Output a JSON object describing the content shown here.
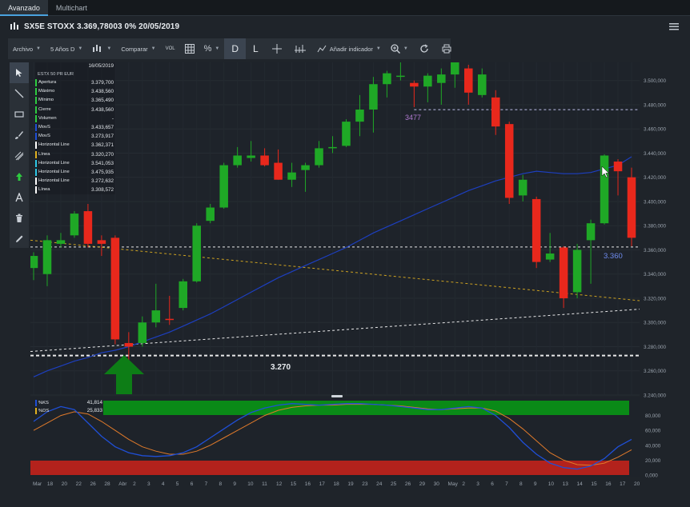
{
  "tabs": [
    {
      "label": "Avanzado",
      "active": true
    },
    {
      "label": "Multichart",
      "active": false
    }
  ],
  "header": {
    "title": "SX5E STOXX 3.369,78003 0% 20/05/2019",
    "icon": "candlestick-icon"
  },
  "toolbar": {
    "archivo": "Archivo",
    "period": "5 Años D",
    "comparar": "Comparar",
    "vol": "VOL",
    "percent": "%",
    "d": "D",
    "l": "L",
    "indicator": "Añadir indicador"
  },
  "data_panel": {
    "date": "16/05/2019",
    "instrument": "ESTX 50 PR EUR",
    "rows": [
      {
        "label": "Apertura",
        "value": "3.379,700",
        "color": "#2ecc40"
      },
      {
        "label": "Máximo",
        "value": "3.438,560",
        "color": "#2ecc40"
      },
      {
        "label": "Mínimo",
        "value": "3.365,490",
        "color": "#2ecc40"
      },
      {
        "label": "Cierre",
        "value": "3.438,560",
        "color": "#2ecc40"
      },
      {
        "label": "Volumen",
        "value": "-",
        "color": "#2ecc40"
      },
      {
        "label": "MovS",
        "value": "3.433,657",
        "color": "#1f4fd6"
      },
      {
        "label": "MovS",
        "value": "3.273,917",
        "color": "#1f4fd6"
      },
      {
        "label": "Horizontal Line",
        "value": "3.362,371",
        "color": "#ffffff"
      },
      {
        "label": "Línea",
        "value": "3.320,270",
        "color": "#e0b020"
      },
      {
        "label": "Horizontal Line",
        "value": "3.541,053",
        "color": "#2ec7e6"
      },
      {
        "label": "Horizontal Line",
        "value": "3.475,935",
        "color": "#2ec7e6"
      },
      {
        "label": "Horizontal Line",
        "value": "3.272,632",
        "color": "#ffffff"
      },
      {
        "label": "Línea",
        "value": "3.308,572",
        "color": "#ffffff"
      }
    ]
  },
  "annotations": {
    "level_3477": "3477",
    "level_3360": "3.360",
    "level_3270": "3.270"
  },
  "oscillator": {
    "rows": [
      {
        "label": "%KS",
        "value": "41,814",
        "color": "#1f4fd6"
      },
      {
        "label": "%DS",
        "value": "25,833",
        "color": "#e0b020"
      }
    ],
    "y_ticks": [
      "80,000",
      "60,000",
      "40,000",
      "20,000",
      "0,000"
    ]
  },
  "chart_data": {
    "type": "candlestick",
    "ylim": [
      3240,
      3515
    ],
    "y_ticks": [
      3240,
      3260,
      3280,
      3300,
      3320,
      3340,
      3360,
      3380,
      3400,
      3420,
      3440,
      3460,
      3480,
      3500
    ],
    "y_tick_labels": [
      "3.240,000",
      "3.260,000",
      "3.280,000",
      "3.300,000",
      "3.320,000",
      "3.340,000",
      "3.360,000",
      "3.380,000",
      "3.400,000",
      "3.420,000",
      "3.440,000",
      "3.460,000",
      "3.480,000",
      "3.500,000"
    ],
    "x_labels": [
      "Mar",
      "18",
      "20",
      "22",
      "26",
      "28",
      "Abr",
      "2",
      "3",
      "4",
      "5",
      "6",
      "7",
      "8",
      "9",
      "10",
      "11",
      "12",
      "15",
      "16",
      "17",
      "18",
      "19",
      "23",
      "24",
      "25",
      "26",
      "29",
      "30",
      "May",
      "2",
      "3",
      "6",
      "7",
      "8",
      "9",
      "10",
      "13",
      "14",
      "15",
      "16",
      "17",
      "20"
    ],
    "candles": [
      {
        "o": 3345,
        "h": 3358,
        "l": 3335,
        "c": 3355
      },
      {
        "o": 3340,
        "h": 3372,
        "l": 3330,
        "c": 3368
      },
      {
        "o": 3365,
        "h": 3374,
        "l": 3362,
        "c": 3368
      },
      {
        "o": 3372,
        "h": 3392,
        "l": 3370,
        "c": 3390
      },
      {
        "o": 3392,
        "h": 3398,
        "l": 3362,
        "c": 3365
      },
      {
        "o": 3368,
        "h": 3372,
        "l": 3355,
        "c": 3365
      },
      {
        "o": 3370,
        "h": 3372,
        "l": 3282,
        "c": 3286
      },
      {
        "o": 3283,
        "h": 3292,
        "l": 3262,
        "c": 3280
      },
      {
        "o": 3283,
        "h": 3305,
        "l": 3280,
        "c": 3300
      },
      {
        "o": 3300,
        "h": 3332,
        "l": 3296,
        "c": 3310
      },
      {
        "o": 3303,
        "h": 3322,
        "l": 3298,
        "c": 3302
      },
      {
        "o": 3312,
        "h": 3336,
        "l": 3310,
        "c": 3334
      },
      {
        "o": 3334,
        "h": 3382,
        "l": 3333,
        "c": 3380
      },
      {
        "o": 3384,
        "h": 3398,
        "l": 3382,
        "c": 3395
      },
      {
        "o": 3395,
        "h": 3432,
        "l": 3394,
        "c": 3430
      },
      {
        "o": 3430,
        "h": 3445,
        "l": 3428,
        "c": 3438
      },
      {
        "o": 3436,
        "h": 3450,
        "l": 3433,
        "c": 3438
      },
      {
        "o": 3438,
        "h": 3444,
        "l": 3429,
        "c": 3430
      },
      {
        "o": 3432,
        "h": 3443,
        "l": 3418,
        "c": 3418
      },
      {
        "o": 3418,
        "h": 3432,
        "l": 3412,
        "c": 3424
      },
      {
        "o": 3426,
        "h": 3432,
        "l": 3408,
        "c": 3430
      },
      {
        "o": 3430,
        "h": 3450,
        "l": 3428,
        "c": 3444
      },
      {
        "o": 3444,
        "h": 3454,
        "l": 3440,
        "c": 3445
      },
      {
        "o": 3446,
        "h": 3468,
        "l": 3445,
        "c": 3466
      },
      {
        "o": 3466,
        "h": 3488,
        "l": 3454,
        "c": 3476
      },
      {
        "o": 3476,
        "h": 3503,
        "l": 3457,
        "c": 3497
      },
      {
        "o": 3497,
        "h": 3508,
        "l": 3486,
        "c": 3506
      },
      {
        "o": 3504,
        "h": 3515,
        "l": 3500,
        "c": 3504
      },
      {
        "o": 3498,
        "h": 3500,
        "l": 3478,
        "c": 3495
      },
      {
        "o": 3495,
        "h": 3506,
        "l": 3482,
        "c": 3504
      },
      {
        "o": 3498,
        "h": 3510,
        "l": 3480,
        "c": 3505
      },
      {
        "o": 3505,
        "h": 3522,
        "l": 3494,
        "c": 3518
      },
      {
        "o": 3510,
        "h": 3513,
        "l": 3480,
        "c": 3490
      },
      {
        "o": 3488,
        "h": 3510,
        "l": 3486,
        "c": 3505
      },
      {
        "o": 3486,
        "h": 3492,
        "l": 3455,
        "c": 3462
      },
      {
        "o": 3464,
        "h": 3466,
        "l": 3398,
        "c": 3403
      },
      {
        "o": 3405,
        "h": 3422,
        "l": 3400,
        "c": 3418
      },
      {
        "o": 3402,
        "h": 3404,
        "l": 3345,
        "c": 3350
      },
      {
        "o": 3352,
        "h": 3374,
        "l": 3350,
        "c": 3357
      },
      {
        "o": 3362,
        "h": 3363,
        "l": 3312,
        "c": 3320
      },
      {
        "o": 3325,
        "h": 3365,
        "l": 3320,
        "c": 3360
      },
      {
        "o": 3368,
        "h": 3385,
        "l": 3332,
        "c": 3382
      },
      {
        "o": 3382,
        "h": 3439,
        "l": 3381,
        "c": 3438
      },
      {
        "o": 3433,
        "h": 3435,
        "l": 3405,
        "c": 3425
      },
      {
        "o": 3420,
        "h": 3428,
        "l": 3363,
        "c": 3370
      }
    ],
    "moving_average_fast": [
      3330,
      3345,
      3355,
      3368,
      3376,
      3380,
      3378,
      3368,
      3358,
      3352,
      3350,
      3352,
      3356,
      3362,
      3370,
      3378,
      3386,
      3392,
      3398,
      3402,
      3406,
      3412,
      3418,
      3426,
      3434,
      3442,
      3450,
      3458,
      3466,
      3474,
      3482,
      3490,
      3496,
      3500,
      3499,
      3494,
      3486,
      3476,
      3462,
      3445,
      3432,
      3426,
      3424,
      3425,
      3428
    ],
    "moving_average_slow": [
      3255,
      3260,
      3264,
      3268,
      3271,
      3275,
      3277,
      3280,
      3284,
      3288,
      3292,
      3297,
      3302,
      3307,
      3313,
      3319,
      3325,
      3331,
      3337,
      3342,
      3347,
      3352,
      3357,
      3362,
      3368,
      3374,
      3379,
      3384,
      3389,
      3394,
      3399,
      3404,
      3409,
      3413,
      3417,
      3420,
      3423,
      3425,
      3424,
      3423,
      3423,
      3424,
      3427,
      3430,
      3437
    ],
    "lines": [
      {
        "name": "Horizontal Line",
        "value": 3362.371,
        "color": "#ffffff",
        "style": "dashed"
      },
      {
        "name": "Horizontal Line",
        "value": 3475.935,
        "color": "#d0d0ff",
        "style": "dashed"
      },
      {
        "name": "Horizontal Line",
        "value": 3272.632,
        "color": "#ffffff",
        "style": "dashed"
      },
      {
        "name": "Línea",
        "from": 3368,
        "to": 3318,
        "color": "#e0b020",
        "style": "dashed"
      },
      {
        "name": "Línea",
        "from": 3276,
        "to": 3311,
        "color": "#ffffff",
        "style": "dashed"
      }
    ],
    "oscillator": {
      "ylim": [
        0,
        100
      ],
      "k": [
        72,
        85,
        92,
        88,
        70,
        52,
        38,
        30,
        26,
        25,
        26,
        30,
        38,
        50,
        62,
        74,
        84,
        90,
        94,
        96,
        95,
        94,
        95,
        96,
        96,
        95,
        94,
        92,
        90,
        88,
        88,
        90,
        92,
        90,
        80,
        64,
        44,
        28,
        16,
        10,
        8,
        12,
        22,
        38,
        48
      ],
      "d": [
        60,
        70,
        80,
        85,
        82,
        72,
        60,
        48,
        38,
        32,
        28,
        28,
        32,
        40,
        50,
        60,
        70,
        80,
        87,
        91,
        93,
        94,
        94,
        95,
        95,
        95,
        94,
        93,
        91,
        89,
        88,
        89,
        90,
        90,
        86,
        76,
        62,
        46,
        30,
        20,
        14,
        13,
        16,
        24,
        34
      ]
    }
  }
}
